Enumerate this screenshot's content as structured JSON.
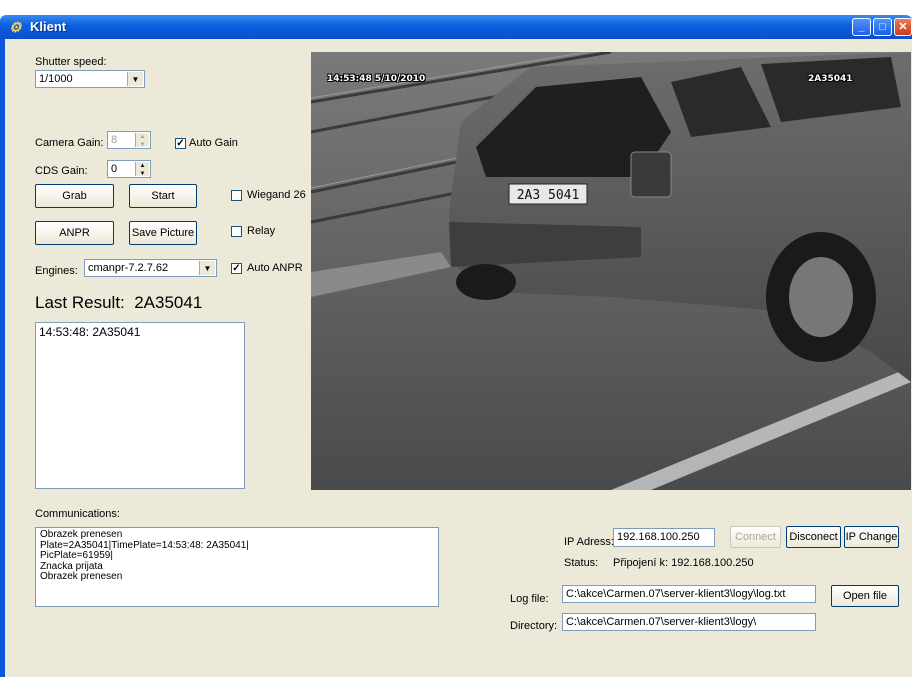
{
  "window": {
    "title": "Klient"
  },
  "controls": {
    "shutter_label": "Shutter speed:",
    "shutter_value": "1/1000",
    "camera_gain_label": "Camera Gain:",
    "camera_gain_value": "8",
    "auto_gain_label": "Auto Gain",
    "cds_gain_label": "CDS Gain:",
    "cds_gain_value": "0",
    "grab_label": "Grab",
    "start_label": "Start",
    "wiegand_label": "Wiegand 26",
    "anpr_label": "ANPR",
    "save_picture_label": "Save Picture",
    "relay_label": "Relay",
    "engines_label": "Engines:",
    "engines_value": "cmanpr-7.2.7.62",
    "auto_anpr_label": "Auto ANPR",
    "auto_gain_checked": true,
    "wiegand_checked": false,
    "relay_checked": false,
    "auto_anpr_checked": true
  },
  "result": {
    "label": "Last Result:",
    "value": "2A35041",
    "list": [
      "14:53:48: 2A35041"
    ]
  },
  "camera": {
    "timestamp": "14:53:48 5/10/2010",
    "plate_overlay": "2A35041",
    "plate_on_car": "2A3 5041"
  },
  "communications": {
    "label": "Communications:",
    "lines": [
      "Obrazek prenesen",
      "Plate=2A35041|TimePlate=14:53:48: 2A35041|",
      "PicPlate=61959|",
      "Znacka prijata",
      "Obrazek prenesen"
    ]
  },
  "connection": {
    "ip_label": "IP Adress:",
    "ip_value": "192.168.100.250",
    "connect_label": "Connect",
    "disconnect_label": "Disconect",
    "ip_change_label": "IP Change",
    "status_label": "Status:",
    "status_value": "Připojení k: 192.168.100.250",
    "log_label": "Log file:",
    "log_value": "C:\\akce\\Carmen.07\\server-klient3\\logy\\log.txt",
    "open_file_label": "Open file",
    "dir_label": "Directory:",
    "dir_value": "C:\\akce\\Carmen.07\\server-klient3\\logy\\"
  },
  "colors": {
    "titlebar": "#0a5fdf",
    "client_bg": "#ece9d8",
    "field_border": "#7f9db9"
  }
}
